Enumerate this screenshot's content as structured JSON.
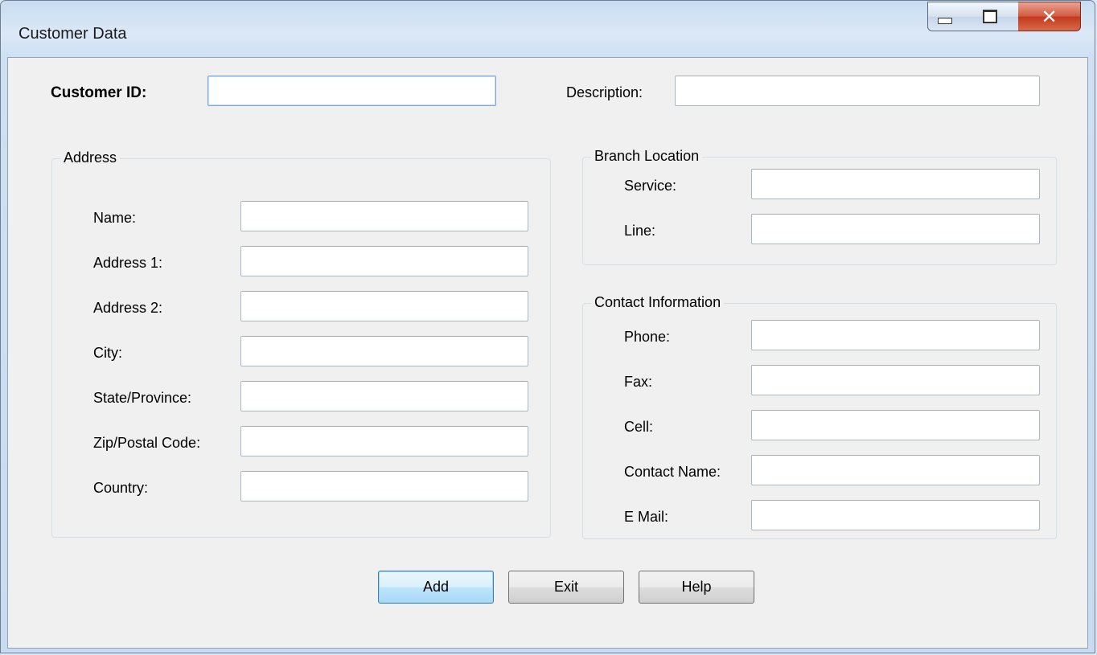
{
  "window": {
    "title": "Customer Data",
    "controls": {
      "minimize": "minimize-icon",
      "maximize": "maximize-icon",
      "close": "close-icon"
    }
  },
  "header": {
    "customer_id_label": "Customer ID:",
    "customer_id_value": "",
    "description_label": "Description:",
    "description_value": ""
  },
  "address": {
    "legend": "Address",
    "fields": [
      {
        "label": "Name:",
        "value": ""
      },
      {
        "label": "Address 1:",
        "value": ""
      },
      {
        "label": "Address 2:",
        "value": ""
      },
      {
        "label": "City:",
        "value": ""
      },
      {
        "label": "State/Province:",
        "value": ""
      },
      {
        "label": "Zip/Postal Code:",
        "value": ""
      },
      {
        "label": "Country:",
        "value": ""
      }
    ]
  },
  "branch": {
    "legend": "Branch Location",
    "fields": [
      {
        "label": "Service:",
        "value": ""
      },
      {
        "label": "Line:",
        "value": ""
      }
    ]
  },
  "contact": {
    "legend": "Contact Information",
    "fields": [
      {
        "label": "Phone:",
        "value": ""
      },
      {
        "label": "Fax:",
        "value": ""
      },
      {
        "label": "Cell:",
        "value": ""
      },
      {
        "label": "Contact Name:",
        "value": ""
      },
      {
        "label": "E Mail:",
        "value": ""
      }
    ]
  },
  "buttons": {
    "add": "Add",
    "exit": "Exit",
    "help": "Help"
  }
}
